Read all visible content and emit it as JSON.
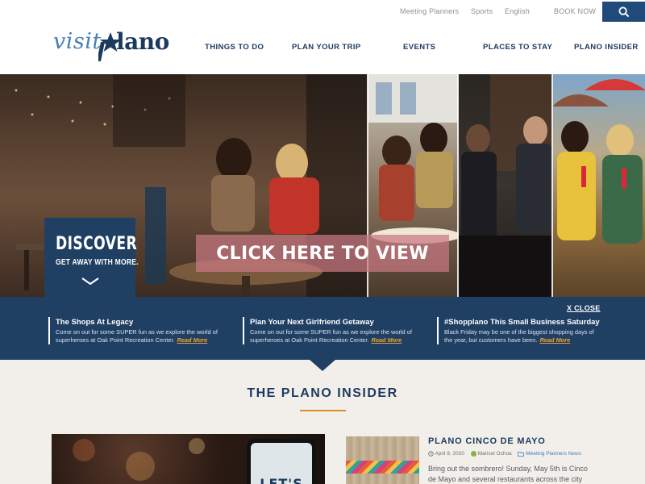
{
  "utility_nav": {
    "meeting_planners": "Meeting Planners",
    "sports": "Sports",
    "language": "English",
    "book_now": "BOOK NOW"
  },
  "search": {
    "icon": "search-icon"
  },
  "logo": {
    "visit": "visit",
    "plano": "lano"
  },
  "main_nav": [
    "THINGS TO DO",
    "PLAN YOUR TRIP",
    "EVENTS",
    "PLACES TO STAY",
    "PLANO INSIDER"
  ],
  "hero": {
    "discover_title": "DISCOVER",
    "discover_subtitle": "GET AWAY WITH MORE.",
    "cta_label": "CLICK HERE TO VIEW"
  },
  "promo": {
    "close_label": "X CLOSE",
    "read_more": "Read More",
    "items": [
      {
        "title": "The Shops At Legacy",
        "desc": "Come on out for some SUPER fun as we explore the world of superheroes at Oak Point Recreation Center."
      },
      {
        "title": "Plan Your Next Girlfriend Getaway",
        "desc": "Come on out for some SUPER fun as we explore the world of superheroes at Oak Point Recreation Center."
      },
      {
        "title": "#Shopplano This Small Business Saturday",
        "desc": "Black Friday may be one of the biggest shopping days of the year, but customers have been."
      }
    ]
  },
  "insider": {
    "title": "THE PLANO INSIDER",
    "phone_text": "LET'S",
    "article": {
      "title": "PLANO CINCO DE MAYO",
      "date": "April 9, 2020",
      "author": "Marisol Ochoa",
      "category": "Meeting Planners News",
      "excerpt": "Bring out the sombrero! Sunday, May 5th is Cinco de Mayo and several restaurants across the city"
    }
  },
  "colors": {
    "navy": "#1f3f63",
    "accent_orange": "#e08a2a",
    "cta_pink": "#c8787f",
    "logo_blue": "#4a7fb6"
  }
}
